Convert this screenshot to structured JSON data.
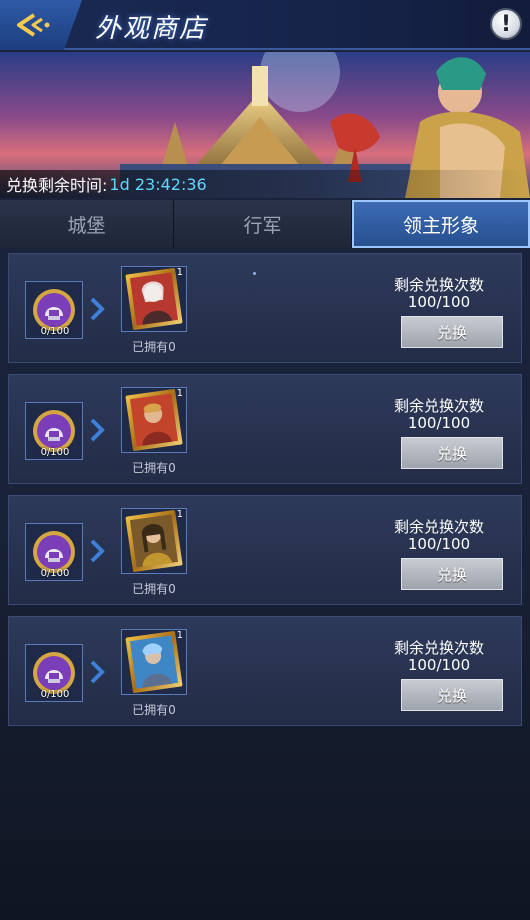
{
  "header": {
    "title": "外观商店"
  },
  "banner": {
    "timer_label": "兑换剩余时间:",
    "timer_value": "1d 23:42:36"
  },
  "tabs": [
    {
      "label": "城堡",
      "active": false
    },
    {
      "label": "行军",
      "active": false
    },
    {
      "label": "领主形象",
      "active": true
    }
  ],
  "items": [
    {
      "material_count": "0/100",
      "reward_qty": "1",
      "owned": "已拥有0",
      "remain_label": "剩余兑换次数",
      "remain_value": "100/100",
      "button": "兑换",
      "portrait_color": "#b7382f"
    },
    {
      "material_count": "0/100",
      "reward_qty": "1",
      "owned": "已拥有0",
      "remain_label": "剩余兑换次数",
      "remain_value": "100/100",
      "button": "兑换",
      "portrait_color": "#c2452b"
    },
    {
      "material_count": "0/100",
      "reward_qty": "1",
      "owned": "已拥有0",
      "remain_label": "剩余兑换次数",
      "remain_value": "100/100",
      "button": "兑换",
      "portrait_color": "#7a5a2a"
    },
    {
      "material_count": "0/100",
      "reward_qty": "1",
      "owned": "已拥有0",
      "remain_label": "剩余兑换次数",
      "remain_value": "100/100",
      "button": "兑换",
      "portrait_color": "#3f86c4"
    }
  ],
  "icons": {
    "back": "back-arrow-icon",
    "info": "exclamation-icon",
    "material": "helmet-token-icon",
    "arrow": "chevron-right-icon"
  },
  "colors": {
    "accent": "#5fd8ff",
    "tab_active": "#3c6bb4",
    "button": "#b5b9c2"
  }
}
